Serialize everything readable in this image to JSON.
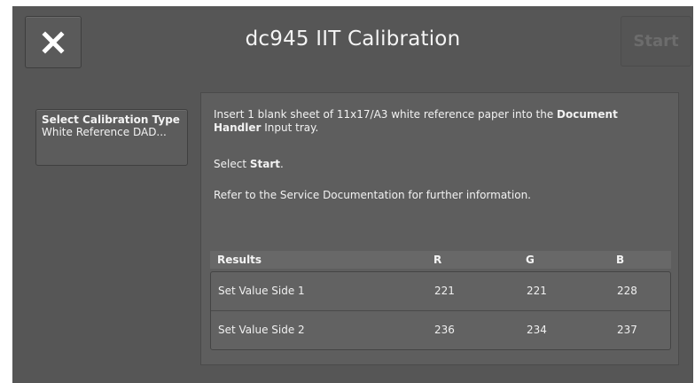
{
  "header": {
    "title": "dc945 IIT Calibration",
    "start_label": "Start",
    "close_icon": "x-icon"
  },
  "calibration_type": {
    "label": "Select Calibration Type",
    "value": "White Reference DAD..."
  },
  "instructions": {
    "line1_pre": "Insert 1 blank sheet of 11x17/A3 white reference paper into the ",
    "line1_bold": "Document Handler",
    "line1_post": " Input tray.",
    "line2_pre": "Select ",
    "line2_bold": "Start",
    "line2_post": ".",
    "line3": "Refer to the Service Documentation for further information."
  },
  "results": {
    "headers": [
      "Results",
      "R",
      "G",
      "B"
    ],
    "rows": [
      {
        "name": "Set Value Side 1",
        "r": "221",
        "g": "221",
        "b": "228"
      },
      {
        "name": "Set Value Side 2",
        "r": "236",
        "g": "234",
        "b": "237"
      }
    ]
  },
  "colors": {
    "background": "#565656",
    "text": "#f2f2f2",
    "disabled_text": "#6c6c6c"
  }
}
